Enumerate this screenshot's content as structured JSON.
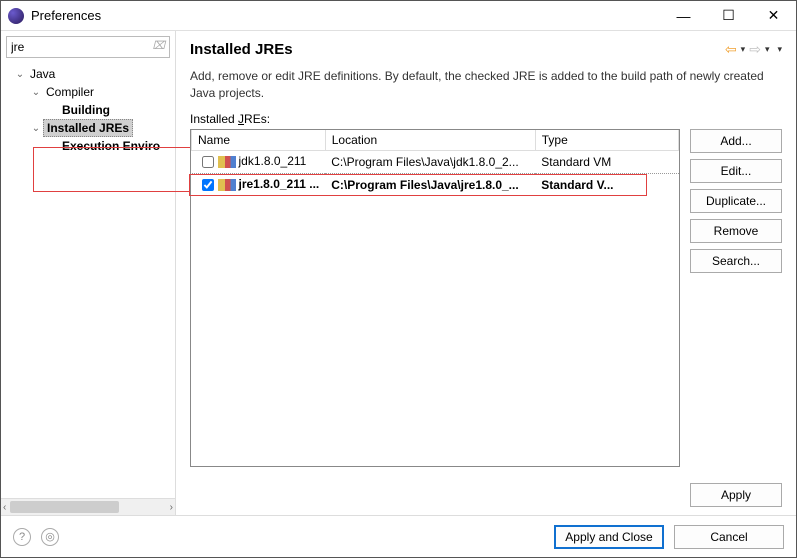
{
  "window": {
    "title": "Preferences",
    "minimize": "—",
    "maximize": "☐",
    "close": "✕"
  },
  "sidebar": {
    "search_value": "jre",
    "search_clear": "⌧",
    "items": [
      {
        "label": "Java",
        "expanded": true,
        "level": 1
      },
      {
        "label": "Compiler",
        "expanded": true,
        "level": 2
      },
      {
        "label": "Building",
        "expanded": false,
        "level": 3,
        "bold": true
      },
      {
        "label": "Installed JREs",
        "expanded": true,
        "level": 2,
        "bold": true,
        "selected": true
      },
      {
        "label": "Execution Enviro",
        "expanded": false,
        "level": 3,
        "bold": true
      }
    ]
  },
  "main": {
    "heading": "Installed JREs",
    "description": "Add, remove or edit JRE definitions. By default, the checked JRE is added to the build path of newly created Java projects.",
    "list_label_pre": "Installed ",
    "list_label_u": "J",
    "list_label_post": "REs:",
    "columns": {
      "name": "Name",
      "location": "Location",
      "type": "Type"
    },
    "rows": [
      {
        "checked": false,
        "name": "jdk1.8.0_211",
        "location": "C:\\Program Files\\Java\\jdk1.8.0_2...",
        "type": "Standard VM"
      },
      {
        "checked": true,
        "name": "jre1.8.0_211 ...",
        "location": "C:\\Program Files\\Java\\jre1.8.0_...",
        "type": "Standard V..."
      }
    ],
    "buttons": {
      "add": "Add...",
      "edit": "Edit...",
      "duplicate": "Duplicate...",
      "remove": "Remove",
      "search": "Search..."
    },
    "apply": "Apply"
  },
  "footer": {
    "apply_close": "Apply and Close",
    "cancel": "Cancel"
  }
}
